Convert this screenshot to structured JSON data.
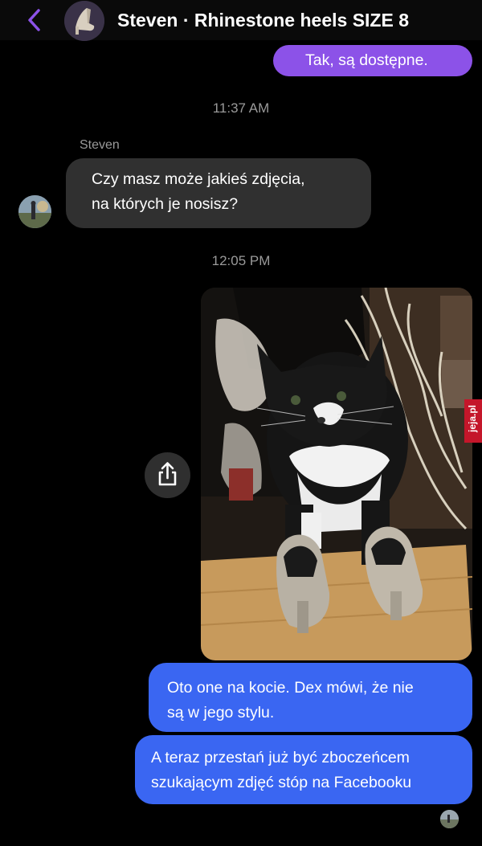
{
  "header": {
    "title": "Steven · Rhinestone heels SIZE 8",
    "back_icon": "chevron-left-icon",
    "accent_color": "#8c52e8"
  },
  "messages": {
    "sent_1": "Tak, są dostępne.",
    "time_1": "11:37 AM",
    "sender_name": "Steven",
    "received_1_line1": "Czy masz może jakieś zdjęcia,",
    "received_1_line2": "na których je nosisz?",
    "time_2": "12:05 PM",
    "photo_icon": "share-icon",
    "sent_2_line1": "Oto one na kocie. Dex mówi, że nie",
    "sent_2_line2": "są w jego stylu.",
    "sent_3_line1": "A teraz przestań już być zboczeńcem",
    "sent_3_line2": "szukającym zdjęć stóp na Facebooku",
    "sent_color": "#3a66f2",
    "received_color": "#303030"
  },
  "watermark": "jeja.pl"
}
